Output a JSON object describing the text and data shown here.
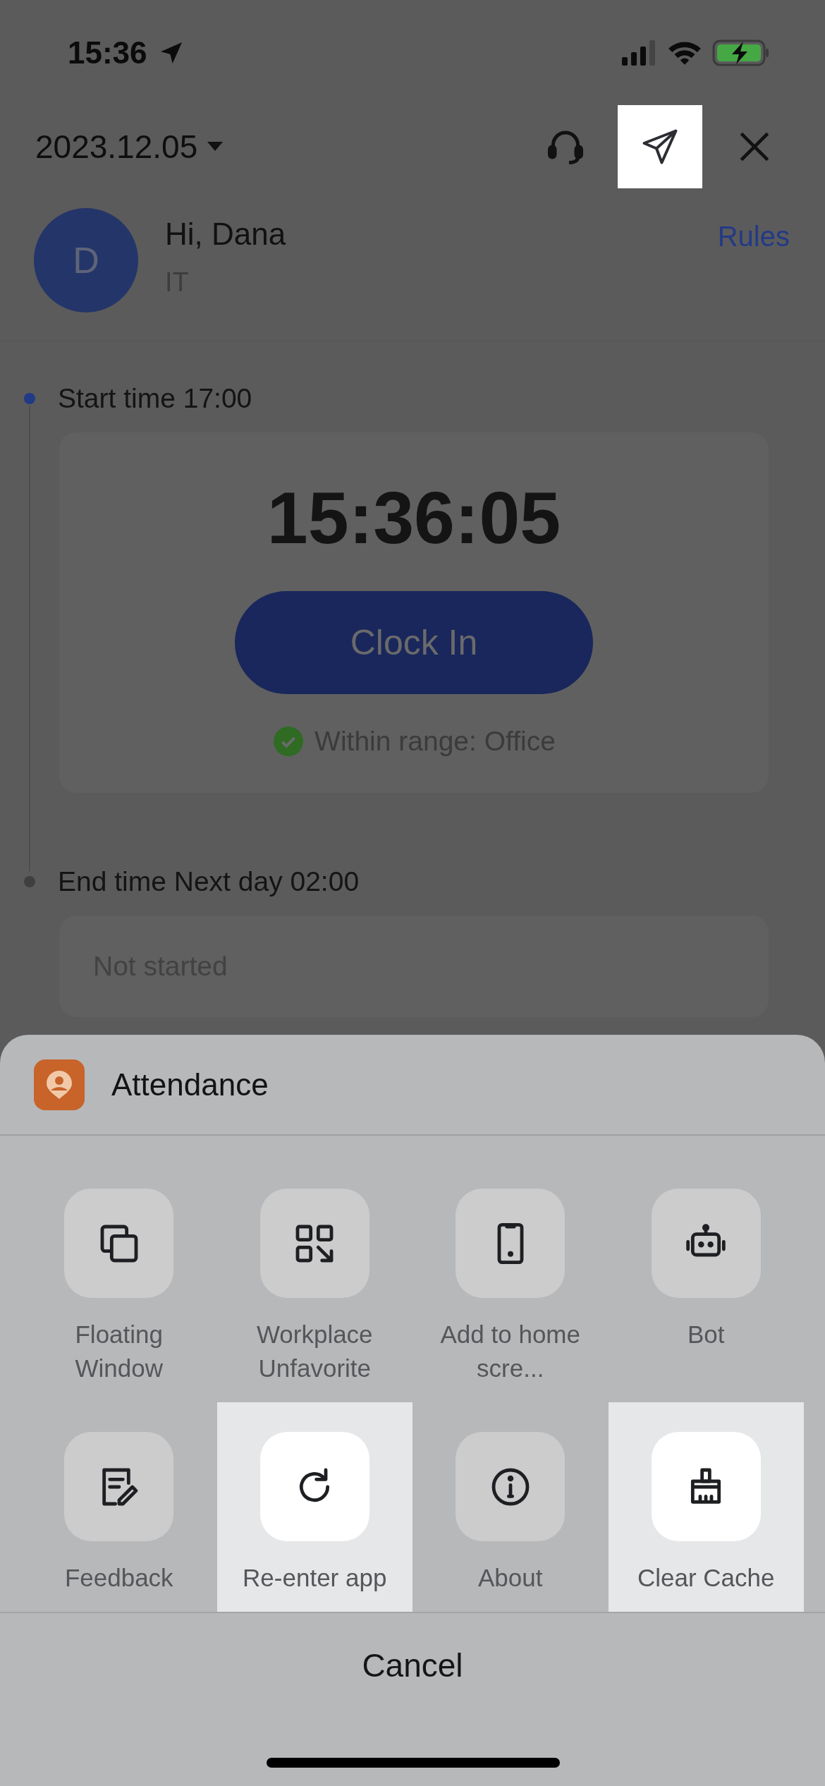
{
  "status_bar": {
    "time": "15:36"
  },
  "header": {
    "date": "2023.12.05",
    "send_highlighted": true
  },
  "profile": {
    "initial": "D",
    "greeting": "Hi, Dana",
    "department": "IT",
    "rules_link": "Rules"
  },
  "timeline": [
    {
      "label": "Start time 17:00",
      "color": "#213a86",
      "kind": "clock",
      "clock": "15:36:05",
      "button": "Clock In",
      "range": "Within range: Office"
    },
    {
      "label": "End time Next day 02:00",
      "color": "#3f3f3f",
      "kind": "pending",
      "status": "Not started"
    }
  ],
  "sheet": {
    "app_name": "Attendance",
    "items": [
      {
        "label": "Floating Window",
        "highlighted": false
      },
      {
        "label": "Workplace Unfavorite",
        "highlighted": false
      },
      {
        "label": "Add to home scre...",
        "highlighted": false
      },
      {
        "label": "Bot",
        "highlighted": false
      },
      {
        "label": "Feedback",
        "highlighted": false
      },
      {
        "label": "Re-enter app",
        "highlighted": true
      },
      {
        "label": "About",
        "highlighted": false
      },
      {
        "label": "Clear Cache",
        "highlighted": true
      }
    ],
    "cancel": "Cancel"
  }
}
